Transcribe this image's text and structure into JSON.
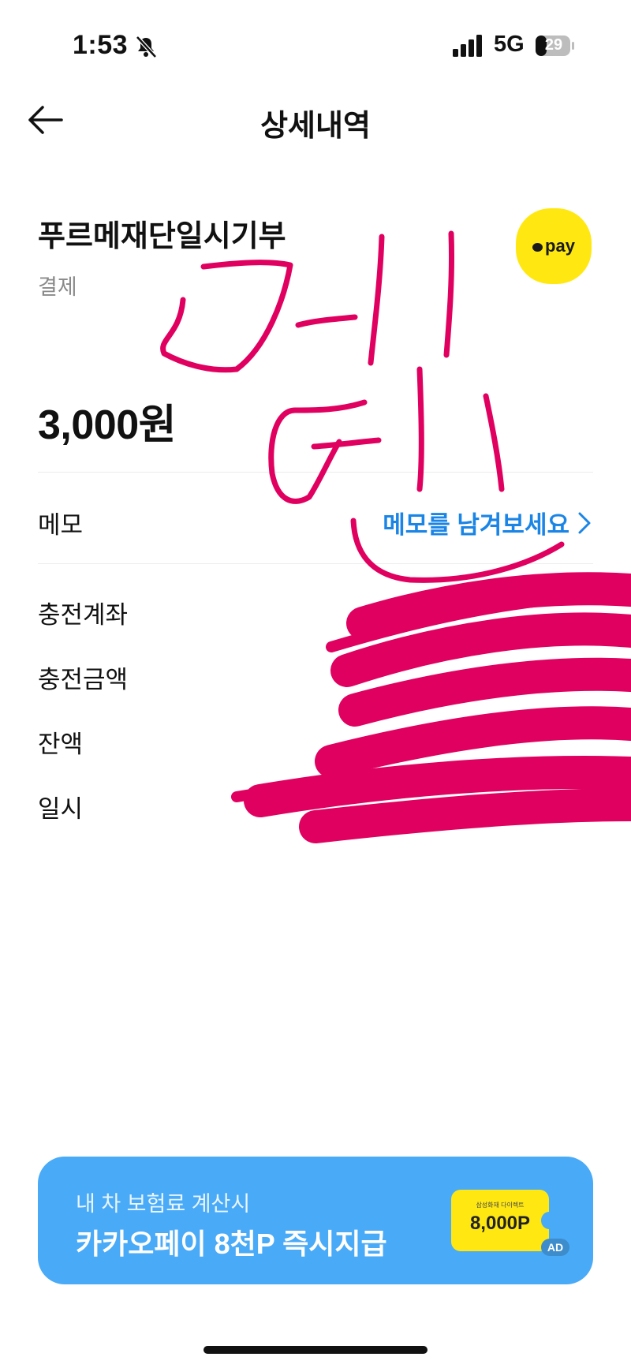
{
  "status_bar": {
    "time": "1:53",
    "network": "5G",
    "battery": "29"
  },
  "nav": {
    "title": "상세내역"
  },
  "transaction": {
    "merchant": "푸르메재단일시기부",
    "type": "결제",
    "amount": "3,000원",
    "logo_text": "pay"
  },
  "memo": {
    "label": "메모",
    "link_text": "메모를 남겨보세요"
  },
  "details": [
    {
      "label": "충전계좌"
    },
    {
      "label": "충전금액"
    },
    {
      "label": "잔액"
    },
    {
      "label": "일시"
    }
  ],
  "ad": {
    "subtitle": "내 차 보험료 계산시",
    "title": "카카오페이 8천P 즉시지급",
    "coupon_brand": "삼성화재 다이렉트",
    "coupon_points": "8,000P",
    "badge": "AD"
  },
  "colors": {
    "accent_link": "#1b85e6",
    "kakao_yellow": "#ffe812",
    "ad_blue": "#49aaf7",
    "scribble": "#e0005f"
  }
}
